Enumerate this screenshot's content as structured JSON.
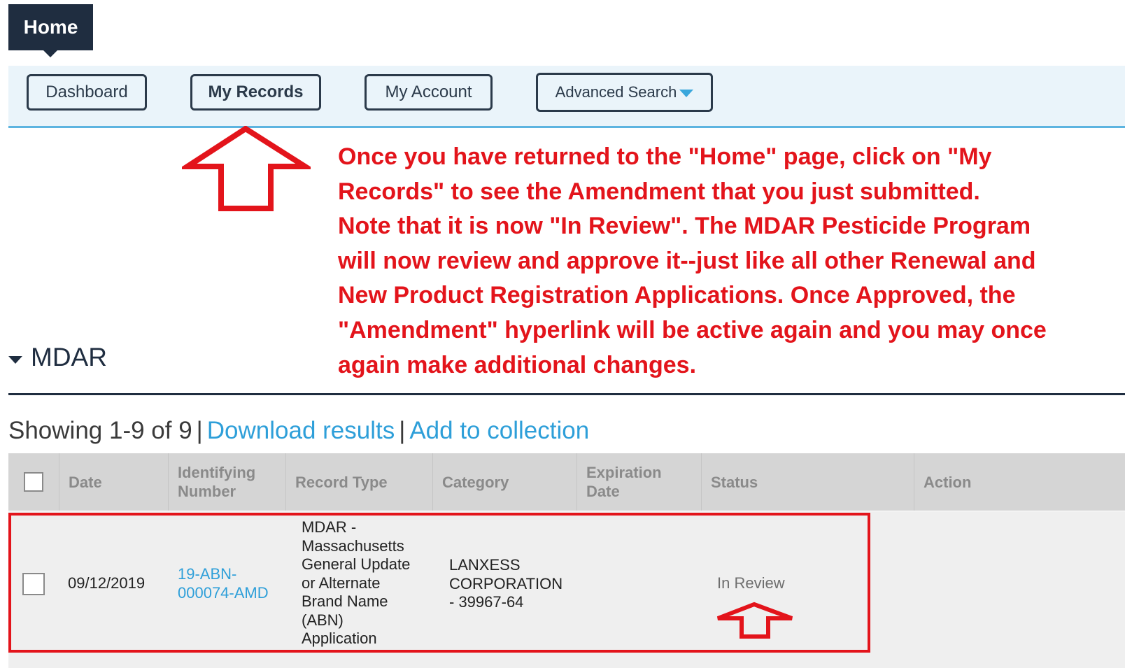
{
  "home_tab": {
    "label": "Home"
  },
  "nav": {
    "dashboard": "Dashboard",
    "my_records": "My Records",
    "my_account": "My Account",
    "advanced_search": "Advanced Search"
  },
  "annotation": {
    "text": "Once you have returned to the \"Home\" page, click on \"My\nRecords\" to see the Amendment that you just submitted.\nNote that it is now \"In Review\".  The MDAR Pesticide Program\nwill now review and approve it--just like all other Renewal and\nNew Product Registration Applications.  Once Approved, the\n\"Amendment\" hyperlink will be active again and you may once\nagain make additional changes."
  },
  "section": {
    "title": "MDAR"
  },
  "results": {
    "showing": "Showing 1-9 of 9",
    "separator": "|",
    "download": "Download results",
    "add_to_collection": "Add to collection"
  },
  "table": {
    "headers": {
      "date": "Date",
      "identifying_number": "Identifying\nNumber",
      "record_type": "Record Type",
      "category": "Category",
      "expiration_date": "Expiration\nDate",
      "status": "Status",
      "action": "Action"
    },
    "rows": [
      {
        "date": "09/12/2019",
        "identifying_number": "19-ABN-\n000074-AMD",
        "record_type": "MDAR -\nMassachusetts\nGeneral Update\nor Alternate\nBrand Name\n(ABN)\nApplication",
        "category": "LANXESS\nCORPORATION\n- 39967-64",
        "expiration_date": "",
        "status": "In Review",
        "action": ""
      }
    ]
  },
  "colors": {
    "annotation_red": "#e3141b",
    "link_blue": "#2e9fd9",
    "nav_dark": "#1f2d40",
    "nav_bg": "#eaf4fa",
    "nav_border_accent": "#5db4e0"
  },
  "icons": {
    "big_arrow": "up-arrow-outline-icon",
    "small_arrow": "up-arrow-outline-icon",
    "dropdown": "caret-down-icon",
    "collapse": "caret-down-icon"
  }
}
